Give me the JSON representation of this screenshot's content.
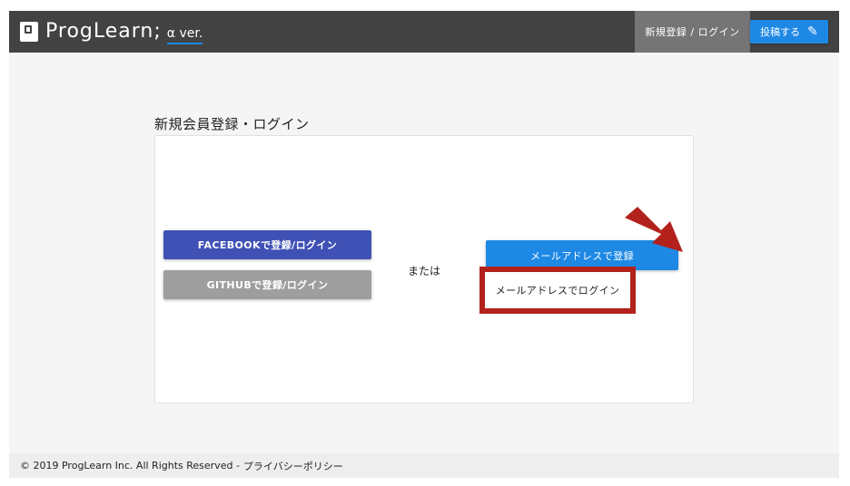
{
  "header": {
    "logo_text": "ProgLearn;",
    "logo_version": "α ver.",
    "login_label": "新規登録 / ログイン",
    "post_label": "投稿する",
    "post_icon": "pencil-icon"
  },
  "main": {
    "title": "新規会員登録・ログイン",
    "facebook_button": "FACEBOOKで登録/ログイン",
    "github_button": "GITHUBで登録/ログイン",
    "or_text": "または",
    "email_register_button": "メールアドレスで登録",
    "email_login_link": "メールアドレスでログイン"
  },
  "annotation": {
    "highlight_color": "#b3211c",
    "icon": "arrow-icon"
  },
  "footer": {
    "copyright": "© 2019 ProgLearn Inc. All Rights Reserved -",
    "privacy_link": "プライバシーポリシー"
  },
  "colors": {
    "header_bg": "#424242",
    "accent_blue": "#1e88e5",
    "facebook_blue": "#3f51b5",
    "github_gray": "#9e9e9e"
  }
}
